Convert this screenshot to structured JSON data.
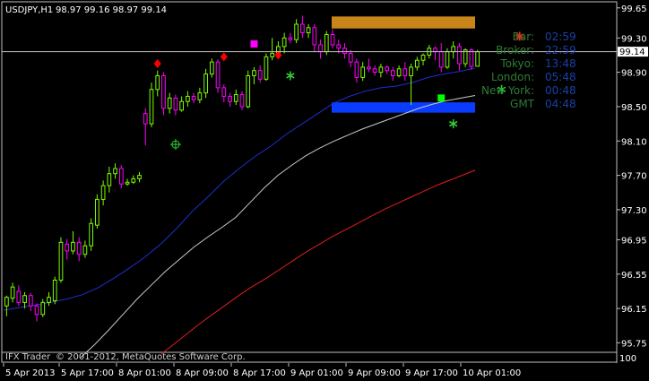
{
  "header": {
    "symbol": "USDJPY,H1",
    "ohlc": "98.97 99.16 98.97 99.14"
  },
  "price_tag": "99.14",
  "clock": {
    "rows": [
      {
        "label": "Bar:",
        "value": "02:59"
      },
      {
        "label": "Broker:",
        "value": "22:59"
      },
      {
        "label": "Tokyo:",
        "value": "13:48"
      },
      {
        "label": "London:",
        "value": "05:48"
      },
      {
        "label": "New York:",
        "value": "00:48"
      },
      {
        "label": "GMT",
        "value": "04:48"
      }
    ]
  },
  "footer": {
    "line1": "IFX Trader",
    "line2": "© 2001-2012, MetaQuotes Software Corp."
  },
  "bottom_right": "100",
  "colors": {
    "bull": "#7CFC00",
    "bear": "#FF00FF",
    "ma_fast": "#1e2fd0",
    "ma_mid": "#c8c8c8",
    "ma_slow": "#e01e1e",
    "grid_line": "#ffffff",
    "res_zone": "#c8861a",
    "sup_zone": "#0a3cff"
  },
  "chart_data": {
    "type": "candlestick",
    "ylim": [
      95.65,
      99.7
    ],
    "y_ticks": [
      "99.65",
      "99.30",
      "98.90",
      "98.50",
      "98.10",
      "97.70",
      "97.30",
      "96.95",
      "96.55",
      "96.15",
      "95.75"
    ],
    "x_ticks": [
      "5 Apr 2013",
      "5 Apr 17:00",
      "8 Apr 01:00",
      "8 Apr 09:00",
      "8 Apr 17:00",
      "9 Apr 01:00",
      "9 Apr 09:00",
      "9 Apr 17:00",
      "10 Apr 01:00"
    ],
    "current_price": 99.14,
    "zones": [
      {
        "name": "resistance",
        "from": 99.41,
        "to": 99.55
      },
      {
        "name": "support",
        "from": 98.43,
        "to": 98.55
      }
    ],
    "candles": [
      [
        96.18,
        96.28,
        96.06,
        96.3
      ],
      [
        96.27,
        96.4,
        96.22,
        96.45
      ],
      [
        96.35,
        96.22,
        96.18,
        96.42
      ],
      [
        96.22,
        96.3,
        96.15,
        96.34
      ],
      [
        96.3,
        96.18,
        96.12,
        96.33
      ],
      [
        96.18,
        96.08,
        96.0,
        96.21
      ],
      [
        96.08,
        96.22,
        96.05,
        96.26
      ],
      [
        96.22,
        96.28,
        96.18,
        96.34
      ],
      [
        96.24,
        96.48,
        96.2,
        96.52
      ],
      [
        96.48,
        96.92,
        96.45,
        96.98
      ],
      [
        96.9,
        96.82,
        96.72,
        96.96
      ],
      [
        96.82,
        96.92,
        96.78,
        97.05
      ],
      [
        96.92,
        96.78,
        96.7,
        96.98
      ],
      [
        96.78,
        96.88,
        96.74,
        96.94
      ],
      [
        96.88,
        97.14,
        96.82,
        97.2
      ],
      [
        97.12,
        97.42,
        97.08,
        97.48
      ],
      [
        97.42,
        97.58,
        97.35,
        97.64
      ],
      [
        97.58,
        97.72,
        97.5,
        97.8
      ],
      [
        97.72,
        97.78,
        97.66,
        97.84
      ],
      [
        97.78,
        97.6,
        97.55,
        97.82
      ],
      [
        97.6,
        97.62,
        97.58,
        97.66
      ],
      [
        97.62,
        97.66,
        97.6,
        97.7
      ],
      [
        97.66,
        97.7,
        97.62,
        97.74
      ],
      [
        98.42,
        98.3,
        98.05,
        98.48
      ],
      [
        98.3,
        98.7,
        98.26,
        98.78
      ],
      [
        98.7,
        98.86,
        98.62,
        98.92
      ],
      [
        98.86,
        98.48,
        98.4,
        98.9
      ],
      [
        98.48,
        98.6,
        98.42,
        98.66
      ],
      [
        98.6,
        98.46,
        98.4,
        98.64
      ],
      [
        98.46,
        98.56,
        98.44,
        98.62
      ],
      [
        98.56,
        98.62,
        98.5,
        98.68
      ],
      [
        98.62,
        98.58,
        98.54,
        98.66
      ],
      [
        98.58,
        98.66,
        98.54,
        98.72
      ],
      [
        98.66,
        98.88,
        98.6,
        98.94
      ],
      [
        98.88,
        99.02,
        98.84,
        99.06
      ],
      [
        99.02,
        98.72,
        98.66,
        99.05
      ],
      [
        98.72,
        98.62,
        98.55,
        98.76
      ],
      [
        98.62,
        98.56,
        98.5,
        98.66
      ],
      [
        98.56,
        98.64,
        98.52,
        98.7
      ],
      [
        98.64,
        98.5,
        98.46,
        98.68
      ],
      [
        98.5,
        98.86,
        98.48,
        98.92
      ],
      [
        98.86,
        98.92,
        98.76,
        98.96
      ],
      [
        98.92,
        98.82,
        98.78,
        98.98
      ],
      [
        98.82,
        99.08,
        98.8,
        99.12
      ],
      [
        99.08,
        99.12,
        99.04,
        99.3
      ],
      [
        99.12,
        99.2,
        99.06,
        99.26
      ],
      [
        99.2,
        99.3,
        99.12,
        99.36
      ],
      [
        99.3,
        99.28,
        99.24,
        99.36
      ],
      [
        99.28,
        99.46,
        99.24,
        99.52
      ],
      [
        99.46,
        99.36,
        99.3,
        99.56
      ],
      [
        99.36,
        99.42,
        99.3,
        99.46
      ],
      [
        99.42,
        99.22,
        99.14,
        99.46
      ],
      [
        99.22,
        99.14,
        99.06,
        99.28
      ],
      [
        99.14,
        99.34,
        99.1,
        99.38
      ],
      [
        99.34,
        99.22,
        99.18,
        99.4
      ],
      [
        99.22,
        99.18,
        99.12,
        99.28
      ],
      [
        99.18,
        99.12,
        99.06,
        99.24
      ],
      [
        99.12,
        99.02,
        98.96,
        99.16
      ],
      [
        99.02,
        98.84,
        98.78,
        99.06
      ],
      [
        98.84,
        98.96,
        98.8,
        99.02
      ],
      [
        98.96,
        98.94,
        98.9,
        99.06
      ],
      [
        98.94,
        98.9,
        98.86,
        98.98
      ],
      [
        98.9,
        98.96,
        98.84,
        99.0
      ],
      [
        98.96,
        98.92,
        98.88,
        98.98
      ],
      [
        98.92,
        98.86,
        98.8,
        98.96
      ],
      [
        98.86,
        98.94,
        98.84,
        98.98
      ],
      [
        98.94,
        98.86,
        98.8,
        99.02
      ],
      [
        98.86,
        98.96,
        98.52,
        99.0
      ],
      [
        98.96,
        99.04,
        98.92,
        99.08
      ],
      [
        99.04,
        99.1,
        98.98,
        99.12
      ],
      [
        99.1,
        99.18,
        99.06,
        99.22
      ],
      [
        99.18,
        99.14,
        99.04,
        99.2
      ],
      [
        99.14,
        98.96,
        98.9,
        99.24
      ],
      [
        98.96,
        99.14,
        98.94,
        99.18
      ],
      [
        99.14,
        99.2,
        99.06,
        99.26
      ],
      [
        99.2,
        99.0,
        98.92,
        99.24
      ],
      [
        99.0,
        99.16,
        98.96,
        99.18
      ],
      [
        99.16,
        98.97,
        98.93,
        99.18
      ],
      [
        98.97,
        99.14,
        98.97,
        99.16
      ]
    ],
    "ma_fast": [
      96.13,
      96.16,
      96.19,
      96.22,
      96.26,
      96.31,
      96.39,
      96.5,
      96.62,
      96.75,
      96.9,
      97.08,
      97.28,
      97.45,
      97.63,
      97.78,
      97.92,
      98.04,
      98.18,
      98.3,
      98.42,
      98.54,
      98.62,
      98.68,
      98.72,
      98.74,
      98.78,
      98.84,
      98.88,
      98.91,
      98.95
    ],
    "ma_mid": [
      95.58,
      95.73,
      95.9,
      96.08,
      96.26,
      96.42,
      96.58,
      96.72,
      96.86,
      96.98,
      97.09,
      97.21,
      97.38,
      97.55,
      97.7,
      97.82,
      97.93,
      98.02,
      98.1,
      98.17,
      98.24,
      98.3,
      98.36,
      98.42,
      98.48,
      98.53,
      98.57,
      98.6,
      98.63
    ],
    "ma_slow": [
      95.62,
      95.74,
      95.86,
      95.98,
      96.09,
      96.2,
      96.31,
      96.41,
      96.5,
      96.6,
      96.7,
      96.8,
      96.89,
      96.98,
      97.06,
      97.14,
      97.22,
      97.3,
      97.37,
      97.44,
      97.51,
      97.58,
      97.64,
      97.7,
      97.76
    ],
    "markers": [
      {
        "kind": "diamond",
        "color": "#ff0000",
        "bar": 25,
        "price": 99.0
      },
      {
        "kind": "diamond",
        "color": "#ff0000",
        "bar": 36,
        "price": 99.08
      },
      {
        "kind": "diamond",
        "color": "#ff0000",
        "bar": 45,
        "price": 99.1
      },
      {
        "kind": "square",
        "color": "#ff00ff",
        "bar": 41,
        "price": 99.23
      },
      {
        "kind": "square",
        "color": "#00ff00",
        "bar": 72,
        "price": 98.6
      },
      {
        "kind": "crosshair",
        "color": "#32cd32",
        "bar": 28,
        "price": 98.06
      },
      {
        "kind": "star",
        "color": "#32cd32",
        "bar": 47,
        "price": 98.86
      },
      {
        "kind": "star",
        "color": "#32cd32",
        "bar": 74,
        "price": 98.3
      },
      {
        "kind": "star",
        "color": "#32cd32",
        "bar": 82,
        "price": 98.7
      },
      {
        "kind": "star",
        "color": "#ff2020",
        "bar": 85,
        "price": 99.32
      }
    ]
  }
}
